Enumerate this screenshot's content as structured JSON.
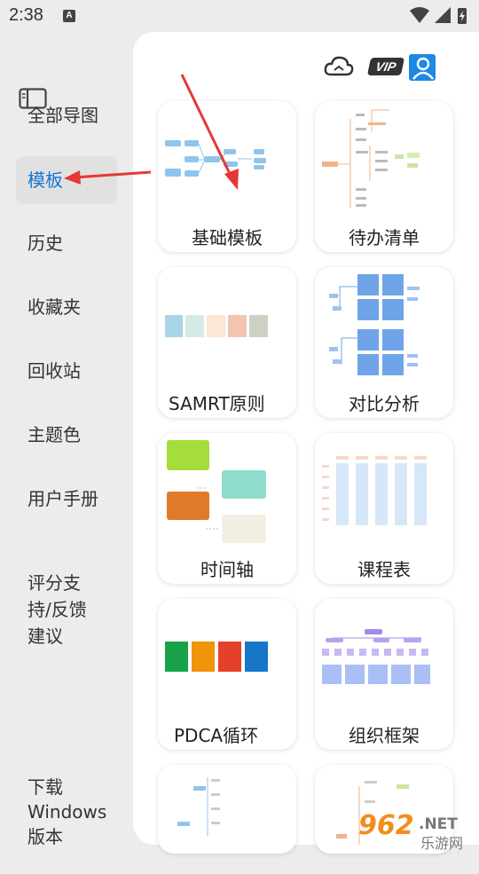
{
  "status": {
    "time": "2:38",
    "notification_letter": "A"
  },
  "sidebar": {
    "items": [
      {
        "label": "全部导图",
        "active": false
      },
      {
        "label": "模板",
        "active": true
      },
      {
        "label": "历史",
        "active": false
      },
      {
        "label": "收藏夹",
        "active": false
      },
      {
        "label": "回收站",
        "active": false
      },
      {
        "label": "主题色",
        "active": false
      },
      {
        "label": "用户手册",
        "active": false
      },
      {
        "label": "评分支\n持/反馈\n建议",
        "active": false
      },
      {
        "label": "下载\nWindows\n版本",
        "active": false
      }
    ]
  },
  "header": {
    "vip_label": "VIP"
  },
  "templates": [
    {
      "label": "基础模板"
    },
    {
      "label": "待办清单"
    },
    {
      "label": "SAMRT原则"
    },
    {
      "label": "对比分析"
    },
    {
      "label": "时间轴"
    },
    {
      "label": "课程表"
    },
    {
      "label": "PDCA循环"
    },
    {
      "label": "组织框架"
    }
  ],
  "watermark": {
    "number": "962",
    "suffix": ".NET",
    "site": "乐游网"
  },
  "colors": {
    "accent": "#1677d2",
    "annotation_arrow": "#e53935"
  }
}
